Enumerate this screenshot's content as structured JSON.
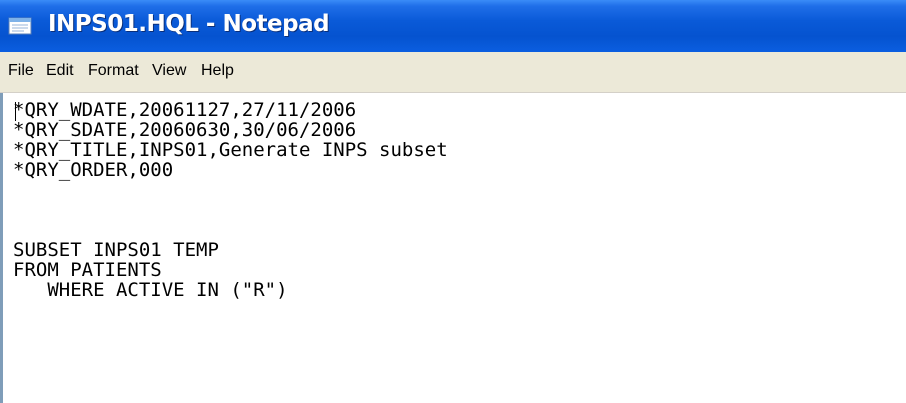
{
  "window": {
    "title": "INPS01.HQL - Notepad",
    "titlebar_color": "#0553d0",
    "icon": "notepad-icon"
  },
  "menu": {
    "items": [
      {
        "label": "File"
      },
      {
        "label": "Edit"
      },
      {
        "label": "Format"
      },
      {
        "label": "View"
      },
      {
        "label": "Help"
      }
    ]
  },
  "editor": {
    "content": "*QRY_WDATE,20061127,27/11/2006\n*QRY_SDATE,20060630,30/06/2006\n*QRY_TITLE,INPS01,Generate INPS subset\n*QRY_ORDER,000\n\n\n\nSUBSET INPS01 TEMP\nFROM PATIENTS\n   WHERE ACTIVE IN (\"R\")"
  }
}
